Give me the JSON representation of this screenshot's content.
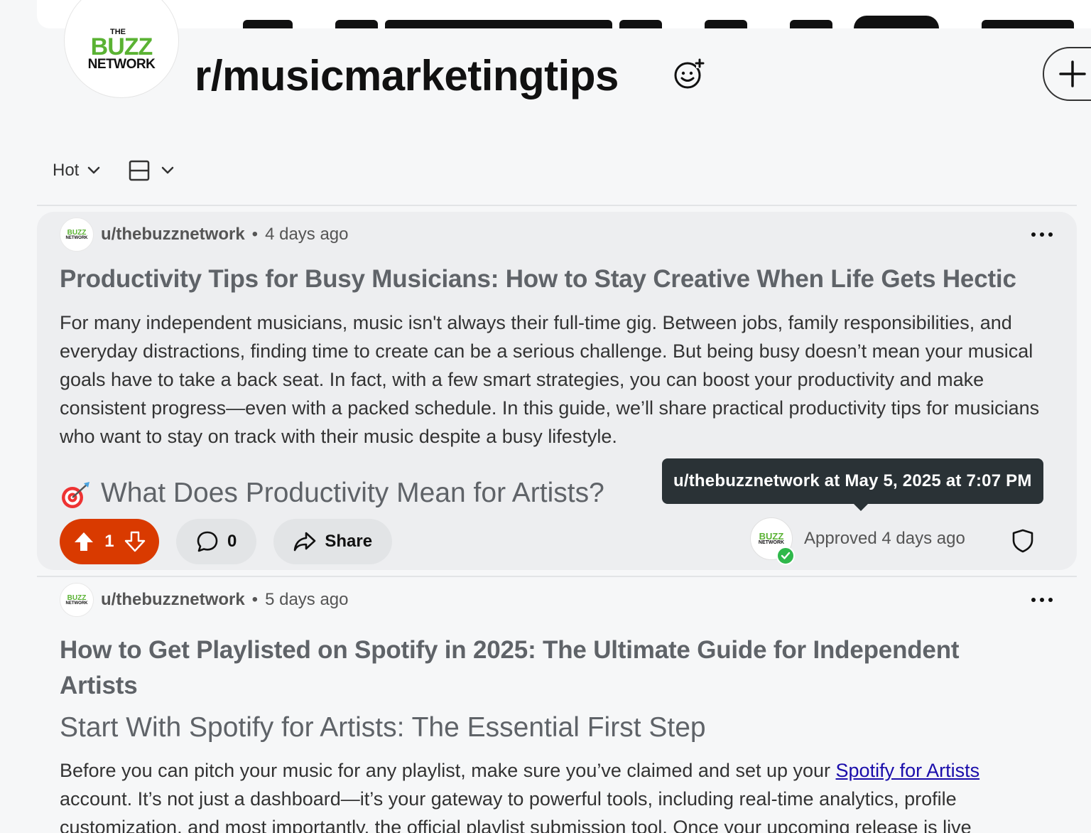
{
  "banner": {
    "logo": {
      "the": "THE",
      "buzz": "BUZZ",
      "network": "NETWORK"
    }
  },
  "subreddit": {
    "name": "r/musicmarketingtips"
  },
  "toolbar": {
    "sort_label": "Hot"
  },
  "posts": [
    {
      "user": "u/thebuzznetwork",
      "age": "4 days ago",
      "title": "Productivity Tips for Busy Musicians: How to Stay Creative When Life Gets Hectic",
      "body": "For many independent musicians, music isn't always their full-time gig. Between jobs, family responsibilities, and everyday distractions, finding time to create can be a serious challenge. But being busy doesn’t mean your musical goals have to take a back seat. In fact, with a few smart strategies, you can boost your productivity and make consistent progress—even with a packed schedule. In this guide, we’ll share practical productivity tips for musicians who want to stay on track with their music despite a busy lifestyle.",
      "heading": "What Does Productivity Mean for Artists?",
      "votes": "1",
      "comments": "0",
      "share_label": "Share",
      "approved": "Approved 4 days ago",
      "tooltip": "u/thebuzznetwork at May 5, 2025 at 7:07 PM"
    },
    {
      "user": "u/thebuzznetwork",
      "age": "5 days ago",
      "title_line1": "How to Get Playlisted on Spotify in 2025: The Ultimate Guide for Independent",
      "title_line2": "Artists",
      "heading": "Start With Spotify for Artists: The Essential First Step",
      "body_line1_pre": "Before you can pitch your music for any playlist, make sure you’ve claimed and set up your ",
      "body_link": "Spotify for Artists",
      "body_line2": "account. It’s not just a dashboard—it’s your gateway to powerful tools, including real-time analytics, profile",
      "body_line3": "customization, and most importantly, the official playlist submission tool. Once your upcoming release is live"
    }
  ],
  "colors": {
    "upvote": "#d93a00",
    "logo_green": "#5ab233",
    "tooltip_bg": "#2a3236",
    "link": "#1a0dab"
  }
}
